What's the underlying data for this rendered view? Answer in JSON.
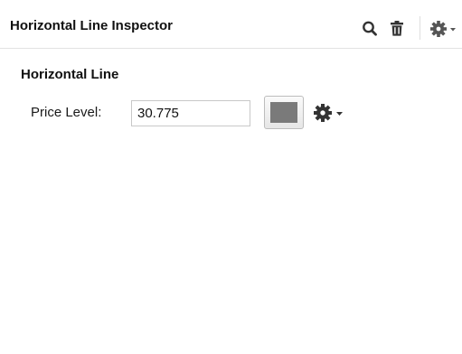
{
  "inspector": {
    "title": "Horizontal Line Inspector",
    "icons": {
      "search": "search-icon",
      "delete": "trash-icon",
      "settings": "gear-icon"
    }
  },
  "section": {
    "title": "Horizontal Line",
    "price_level": {
      "label": "Price Level:",
      "value": "30.775"
    },
    "line_color": "#7a7a7a"
  }
}
